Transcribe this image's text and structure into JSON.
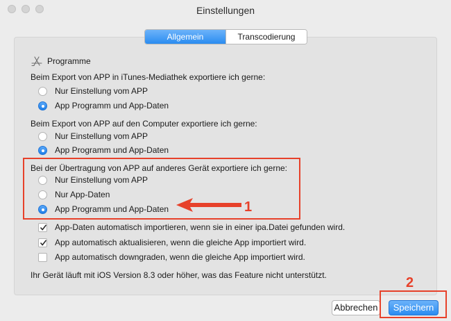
{
  "window": {
    "title": "Einstellungen"
  },
  "tabs": [
    {
      "label": "Allgemein",
      "active": true
    },
    {
      "label": "Transcodierung",
      "active": false
    }
  ],
  "section": {
    "title": "Programme",
    "icon": "app-store-icon"
  },
  "group1": {
    "heading": "Beim Export von APP in iTunes-Mediathek exportiere ich gerne:",
    "options": [
      "Nur Einstellung vom APP",
      "App Programm und App-Daten"
    ],
    "selected": 1
  },
  "group2": {
    "heading": "Beim Export von APP auf den Computer exportiere ich gerne:",
    "options": [
      "Nur Einstellung vom APP",
      "App Programm und App-Daten"
    ],
    "selected": 1
  },
  "group3": {
    "heading": "Bei der Übertragung von APP auf anderes Gerät exportiere ich gerne:",
    "options": [
      "Nur Einstellung vom APP",
      "Nur App-Daten",
      "App Programm und App-Daten"
    ],
    "selected": 2
  },
  "checkboxes": [
    {
      "label": "App-Daten automatisch importieren, wenn sie in einer ipa.Datei gefunden wird.",
      "checked": true
    },
    {
      "label": "App automatisch aktualisieren, wenn die gleiche App importiert wird.",
      "checked": true
    },
    {
      "label": "App automatisch downgraden, wenn die gleiche App importiert wird.",
      "checked": false
    }
  ],
  "note": "Ihr Gerät läuft mit iOS Version 8.3 oder höher, was das Feature nicht unterstützt.",
  "buttons": {
    "cancel": "Abbrechen",
    "save": "Speichern"
  },
  "annotations": {
    "marker1": "1",
    "marker2": "2",
    "color": "#e7412a"
  },
  "colors": {
    "accent": "#2a8cf0"
  }
}
